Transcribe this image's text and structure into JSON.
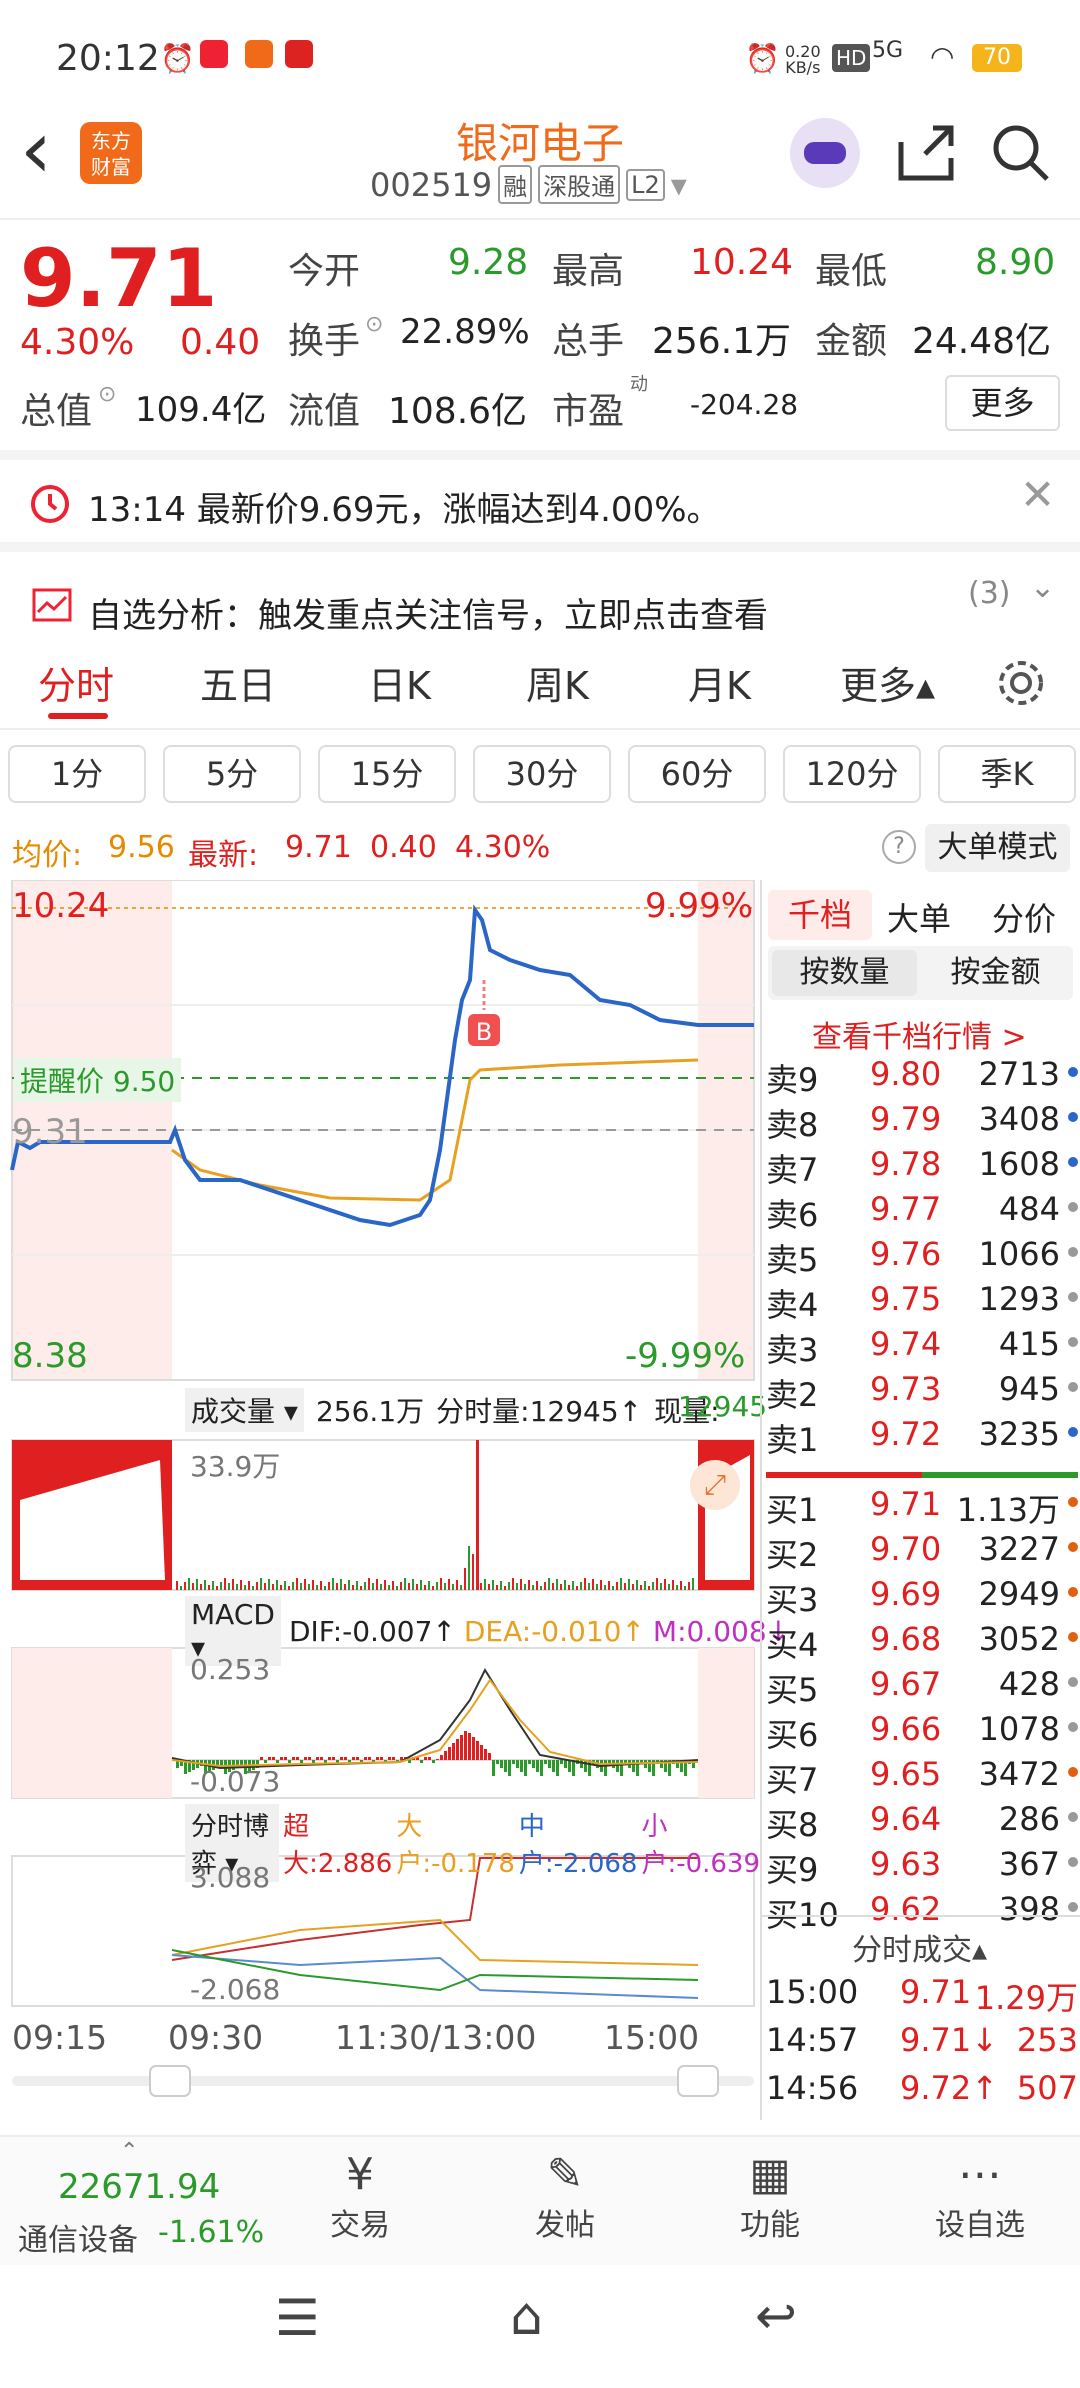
{
  "status": {
    "time": "20:12",
    "net": "0.20",
    "net_unit": "KB/s",
    "hd": "HD",
    "signal": "5G",
    "battery": "70"
  },
  "header": {
    "back": "‹",
    "logo": "东方\n财富",
    "title": "银河电子",
    "code": "002519",
    "tags": [
      "融",
      "深股通",
      "L2"
    ],
    "dropdown": "▾"
  },
  "quote": {
    "price": "9.71",
    "pct": "4.30%",
    "chg": "0.40",
    "open_label": "今开",
    "open": "9.28",
    "high_label": "最高",
    "high": "10.24",
    "low_label": "最低",
    "low": "8.90",
    "turnover_label": "换手",
    "turnover": "22.89%",
    "vol_label": "总手",
    "vol": "256.1万",
    "amt_label": "金额",
    "amt": "24.48亿",
    "mcap_label": "总值",
    "mcap": "109.4亿",
    "float_label": "流值",
    "float": "108.6亿",
    "pe_label": "市盈",
    "pe_sup": "动",
    "pe": "-204.28",
    "more": "更多"
  },
  "alerts": {
    "msg1": "13:14 最新价9.69元，涨幅达到4.00%。",
    "msg2": "自选分析：触发重点关注信号，立即点击查看",
    "count": "(3)"
  },
  "tabs": [
    "分时",
    "五日",
    "日K",
    "周K",
    "月K",
    "更多▴"
  ],
  "periods": [
    "1分",
    "5分",
    "15分",
    "30分",
    "60分",
    "120分",
    "季K"
  ],
  "info": {
    "avg_label": "均价:",
    "avg": "9.56",
    "last_label": "最新:",
    "last": "9.71",
    "chg": "0.40",
    "pct": "4.30%",
    "mode": "大单模式",
    "help": "?"
  },
  "chart": {
    "ymax": "10.24",
    "ymin": "8.38",
    "pmax": "9.99%",
    "pmin": "-9.99%",
    "prev": "9.31",
    "alert": "提醒价 9.50",
    "b_mark": "B",
    "vol_label": "成交量",
    "vol_total": "256.1万",
    "vol_fen": "分时量:12945↑",
    "vol_now_label": "现量:",
    "vol_now": "12945",
    "vol_max": "33.9万",
    "macd_label": "MACD",
    "dif": "DIF:-0.007↑",
    "dea": "DEA:-0.010↑",
    "m": "M:0.008↓",
    "macd_max": "0.253",
    "macd_min": "-0.073",
    "game_label": "分时博弈",
    "cd": "超大:2.886",
    "dd": "大户:-0.178",
    "zh": "中户:-2.068",
    "xh": "小户:-0.639",
    "game_max": "3.088",
    "game_min": "-2.068",
    "times": [
      "09:15",
      "09:30",
      "11:30/13:00",
      "15:00"
    ]
  },
  "book": {
    "tabs": [
      "千档",
      "大单",
      "分价"
    ],
    "subtabs": [
      "按数量",
      "按金额"
    ],
    "link": "查看千档行情 >",
    "asks": [
      [
        "卖9",
        "9.80",
        "2713"
      ],
      [
        "卖8",
        "9.79",
        "3408"
      ],
      [
        "卖7",
        "9.78",
        "1608"
      ],
      [
        "卖6",
        "9.77",
        "484"
      ],
      [
        "卖5",
        "9.76",
        "1066"
      ],
      [
        "卖4",
        "9.75",
        "1293"
      ],
      [
        "卖3",
        "9.74",
        "415"
      ],
      [
        "卖2",
        "9.73",
        "945"
      ],
      [
        "卖1",
        "9.72",
        "3235"
      ]
    ],
    "bids": [
      [
        "买1",
        "9.71",
        "1.13万"
      ],
      [
        "买2",
        "9.70",
        "3227"
      ],
      [
        "买3",
        "9.69",
        "2949"
      ],
      [
        "买4",
        "9.68",
        "3052"
      ],
      [
        "买5",
        "9.67",
        "428"
      ],
      [
        "买6",
        "9.66",
        "1078"
      ],
      [
        "买7",
        "9.65",
        "3472"
      ],
      [
        "买8",
        "9.64",
        "286"
      ],
      [
        "买9",
        "9.63",
        "367"
      ],
      [
        "买10",
        "9.62",
        "398"
      ]
    ],
    "trades_title": "分时成交▴",
    "trades": [
      [
        "15:00",
        "9.71",
        "1.29万"
      ],
      [
        "14:57",
        "9.71↓",
        "253"
      ],
      [
        "14:56",
        "9.72↑",
        "507"
      ]
    ]
  },
  "bottom": {
    "index": "22671.94",
    "sector": "通信设备",
    "sector_pct": "-1.61%",
    "items": [
      "交易",
      "发帖",
      "功能",
      "设自选"
    ]
  }
}
